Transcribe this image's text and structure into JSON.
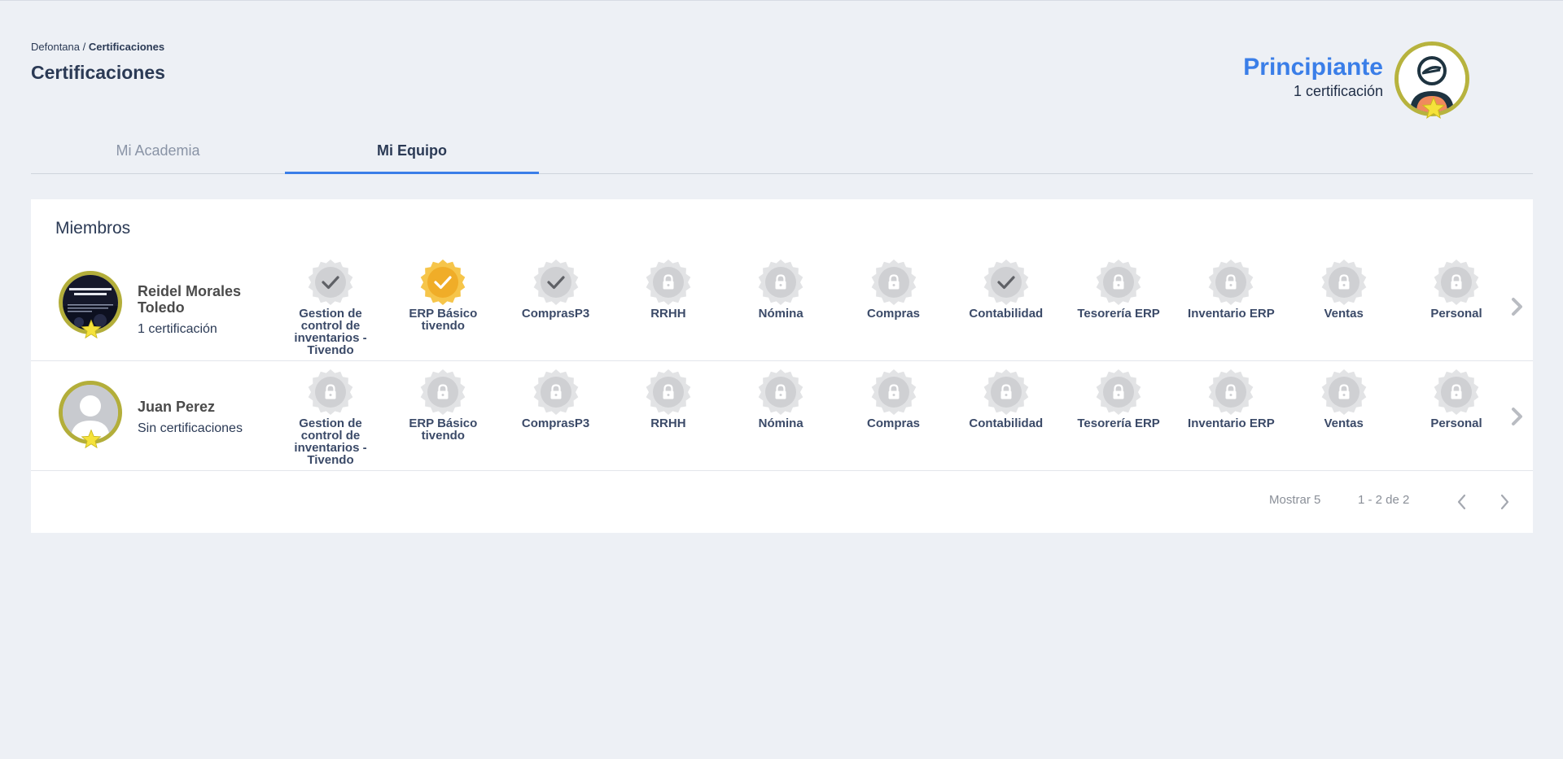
{
  "breadcrumb": {
    "root": "Defontana",
    "separator": " / ",
    "current": "Certificaciones"
  },
  "page_title": "Certificaciones",
  "level": {
    "name": "Principiante",
    "count": "1 certificación"
  },
  "tabs": [
    {
      "label": "Mi Academia",
      "active": false
    },
    {
      "label": "Mi Equipo",
      "active": true
    }
  ],
  "members_title": "Miembros",
  "members": [
    {
      "name": "Reidel Morales Toledo",
      "subtitle": "1 certificación",
      "badges": [
        {
          "label": "Gestion de control de inventarios - Tivendo",
          "state": "completed"
        },
        {
          "label": "ERP Básico tivendo",
          "state": "gold"
        },
        {
          "label": "ComprasP3",
          "state": "completed"
        },
        {
          "label": "RRHH",
          "state": "locked"
        },
        {
          "label": "Nómina",
          "state": "locked"
        },
        {
          "label": "Compras",
          "state": "locked"
        },
        {
          "label": "Contabilidad",
          "state": "completed"
        },
        {
          "label": "Tesorería ERP",
          "state": "locked"
        },
        {
          "label": "Inventario ERP",
          "state": "locked"
        },
        {
          "label": "Ventas",
          "state": "locked"
        },
        {
          "label": "Personal",
          "state": "locked"
        }
      ]
    },
    {
      "name": "Juan Perez",
      "subtitle": "Sin certificaciones",
      "badges": [
        {
          "label": "Gestion de control de inventarios - Tivendo",
          "state": "locked"
        },
        {
          "label": "ERP Básico tivendo",
          "state": "locked"
        },
        {
          "label": "ComprasP3",
          "state": "locked"
        },
        {
          "label": "RRHH",
          "state": "locked"
        },
        {
          "label": "Nómina",
          "state": "locked"
        },
        {
          "label": "Compras",
          "state": "locked"
        },
        {
          "label": "Contabilidad",
          "state": "locked"
        },
        {
          "label": "Tesorería ERP",
          "state": "locked"
        },
        {
          "label": "Inventario ERP",
          "state": "locked"
        },
        {
          "label": "Ventas",
          "state": "locked"
        },
        {
          "label": "Personal",
          "state": "locked"
        }
      ]
    }
  ],
  "pager": {
    "show": "Mostrar 5",
    "range": "1 - 2 de 2"
  },
  "colors": {
    "accent": "#3a7ee8",
    "background": "#edf0f5",
    "level_ring": "#b7b33e",
    "badge_gold": "#f2b834",
    "badge_gray": "#d9dadc"
  },
  "icons": {
    "profile": "user-avatar-icon",
    "star": "star-icon",
    "badge_locked": "lock-icon",
    "badge_done": "check-icon",
    "row_next": "chevron-right-icon",
    "page_prev": "chevron-left-icon",
    "page_next": "chevron-right-icon"
  }
}
